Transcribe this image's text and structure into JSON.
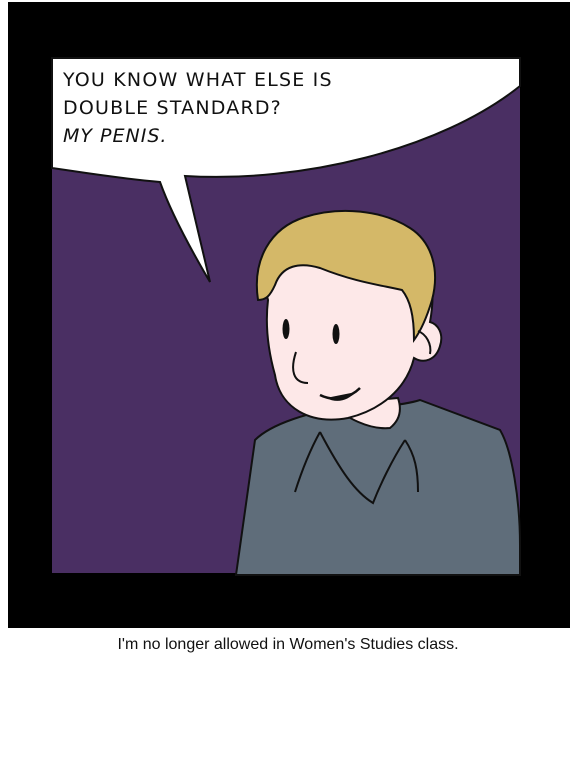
{
  "comic": {
    "speech_lines": [
      "YOU KNOW WHAT ELSE IS",
      "DOUBLE STANDARD?",
      "MY PENIS."
    ],
    "caption": "I'm no longer allowed in Women's Studies class."
  },
  "colors": {
    "frame": "#000000",
    "background_purple": "#4a2f63",
    "shirt": "#5f6d7a",
    "skin": "#fde8e8",
    "hair": "#d4b868",
    "bubble": "#ffffff"
  }
}
